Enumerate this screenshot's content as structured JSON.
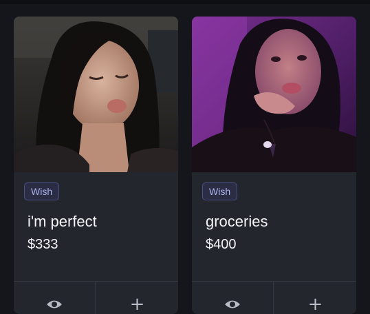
{
  "items": [
    {
      "badge": "Wish",
      "title": "i'm perfect",
      "price": "$333",
      "photo_icon": "photo-placeholder",
      "view_icon": "eye-icon",
      "add_icon": "plus-icon",
      "add_symbol": "+"
    },
    {
      "badge": "Wish",
      "title": "groceries",
      "price": "$400",
      "photo_icon": "photo-placeholder",
      "view_icon": "eye-icon",
      "add_icon": "plus-icon",
      "add_symbol": "+"
    }
  ],
  "colors": {
    "background": "#15161b",
    "card": "#24262d",
    "badge_border": "#4a4f86",
    "badge_text": "#aeb4ee",
    "text": "#f3f4f7"
  }
}
